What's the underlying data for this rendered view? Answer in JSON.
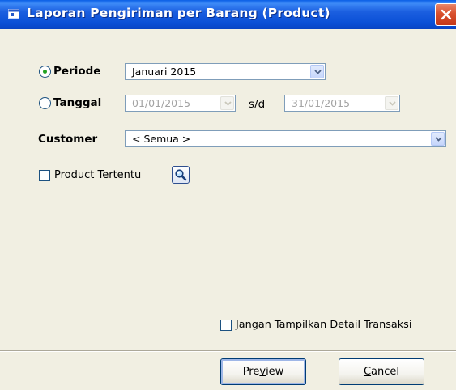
{
  "window": {
    "title": "Laporan Pengiriman per Barang (Product)"
  },
  "periode": {
    "label": "Periode",
    "selected_value": "Januari 2015",
    "checked": true
  },
  "tanggal": {
    "label": "Tanggal",
    "from_value": "01/01/2015",
    "separator": "s/d",
    "to_value": "31/01/2015",
    "checked": false
  },
  "customer": {
    "label": "Customer",
    "selected_value": "< Semua >"
  },
  "product_filter": {
    "label": "Product Tertentu",
    "checked": false
  },
  "hide_detail": {
    "label": "Jangan Tampilkan Detail Transaksi",
    "checked": false
  },
  "buttons": {
    "preview": {
      "pre": "Pre",
      "accel": "v",
      "post": "iew"
    },
    "cancel": {
      "pre": "",
      "accel": "C",
      "post": "ancel"
    }
  },
  "colors": {
    "titlebar": "#0a4fd6",
    "dialog_bg": "#f1efe2",
    "close_button": "#d9502d",
    "radio_dot": "#21a121"
  },
  "icons": [
    "window-app-icon",
    "close-icon",
    "chevron-down-icon",
    "magnifier-icon"
  ]
}
